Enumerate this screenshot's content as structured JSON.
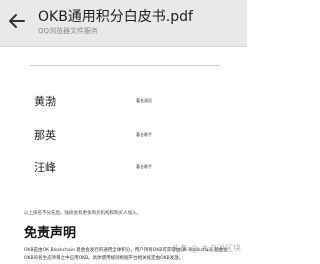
{
  "header": {
    "title": "OKB通用积分白皮书.pdf",
    "subtitle": "QQ浏览器文件服务"
  },
  "people": [
    {
      "name": "黄渤",
      "role": "著名演员"
    },
    {
      "name": "那英",
      "role": "著名歌手"
    },
    {
      "name": "汪峰",
      "role": "著名歌手"
    }
  ],
  "footnote": "以上排名不分先后。陆续会有更多购买机构和购买人加入。",
  "disclaimer_title": "免责声明",
  "paragraphs": [
    "OKB是由OK Blockchain 基金会发行的通用全球积分，用户持有OKB可获得由OK Blockchain 基金会",
    "OKB的各生态项目之中应用OKB。具体使用规则根据平台相关规定由OKB发放。"
  ],
  "watermark": "头条 @ 大叔说区块"
}
